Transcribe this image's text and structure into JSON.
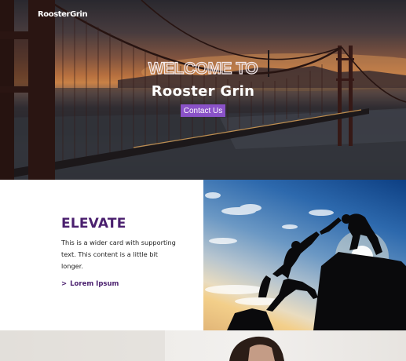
{
  "header": {
    "logo_text": "RoosterGrin"
  },
  "hero": {
    "welcome_text": "WELCOME TO",
    "brand_name": "Rooster Grin",
    "cta_label": "Contact Us"
  },
  "card": {
    "title": "ELEVATE",
    "text": "This is a wider card with supporting text. This content is a little bit longer.",
    "link_arrow": ">",
    "link_label": "Lorem Ipsum"
  },
  "colors": {
    "accent_purple": "#8a52c8",
    "title_purple": "#4a1f6e"
  }
}
